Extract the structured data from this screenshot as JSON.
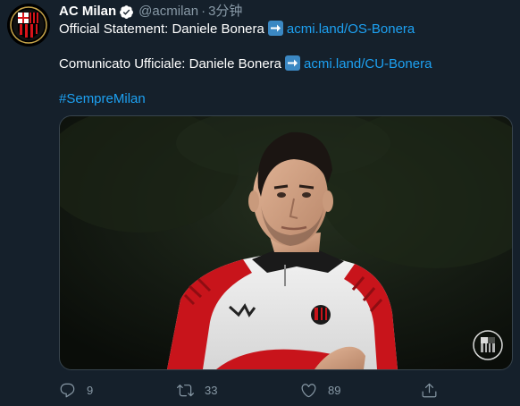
{
  "account": {
    "name": "AC Milan",
    "handle": "@acmilan",
    "separator": "·",
    "time": "3分钟"
  },
  "tweet": {
    "line1_text": "Official Statement: Daniele Bonera",
    "line1_link": "acmi.land/OS-Bonera",
    "line2_text": "Comunicato Ufficiale: Daniele Bonera",
    "line2_link": "acmi.land/CU-Bonera",
    "hashtag": "#SempreMilan"
  },
  "media": {
    "watermark_logo": "ac-milan-crest"
  },
  "actions": {
    "reply_count": "9",
    "retweet_count": "33",
    "like_count": "89"
  },
  "icons": {
    "verified": "verified-badge-icon",
    "arrow": "right-arrow-emoji-icon",
    "reply": "reply-icon",
    "retweet": "retweet-icon",
    "like": "heart-icon",
    "share": "share-icon"
  },
  "colors": {
    "background": "#15202b",
    "link": "#1da1f2",
    "muted": "#8899a6",
    "milan_red": "#d7141a"
  }
}
